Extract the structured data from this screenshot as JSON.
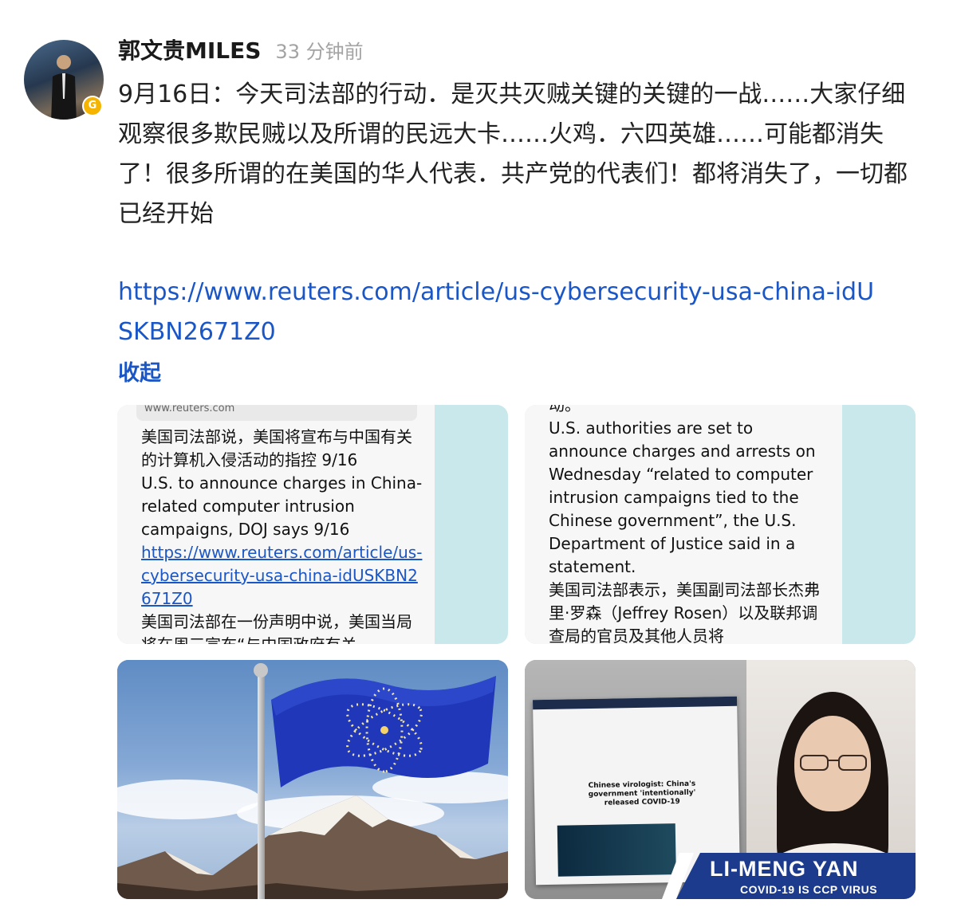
{
  "post": {
    "author_name": "郭文贵MILES",
    "timestamp": "33 分钟前",
    "badge_letter": "G",
    "text": "9月16日：今天司法部的行动．是灭共灭贼关键的关键的一战……大家仔细观察很多欺民贼以及所谓的民远大卡……火鸡．六四英雄……可能都消失了！很多所谓的在美国的华人代表．共产党的代表们！都将消失了，一切都已经开始",
    "link": "https://www.reuters.com/article/us-cybersecurity-usa-china-idUSKBN2671Z0",
    "collapse_label": "收起"
  },
  "images": [
    {
      "url_bar": "www.reuters.com",
      "lines": [
        "美国司法部说，美国将宣布与中国有关的计算机入侵活动的指控 9/16",
        "U.S. to announce charges in China-related computer intrusion campaigns, DOJ says 9/16"
      ],
      "link": "https://www.reuters.com/article/us-cybersecurity-usa-china-idUSKBN2671Z0",
      "after": "美国司法部在一份声明中说，美国当局将在周三宣布“与中国政府有关"
    },
    {
      "top_cut": "动。",
      "paragraph_en": "U.S. authorities are set to announce charges and arrests on Wednesday “related to computer intrusion campaigns tied to the Chinese government”, the U.S. Department of Justice said in a statement.",
      "paragraph_zh": "美国司法部表示，美国副司法部长杰弗里·罗森（Jeffrey Rosen）以及联邦调查局的官员及其他人员将"
    },
    {
      "alt": "flag-over-mountains"
    },
    {
      "headline": "Chinese virologist: China's government 'intentionally' released COVID-19",
      "banner_title": "LI-MENG YAN",
      "banner_subtitle": "COVID-19 IS CCP VIRUS"
    }
  ],
  "colors": {
    "link": "#1a56c6",
    "timestamp": "#a3a3a3",
    "tile_bg": "#c8e8ec",
    "banner": "#1c3b8c"
  }
}
